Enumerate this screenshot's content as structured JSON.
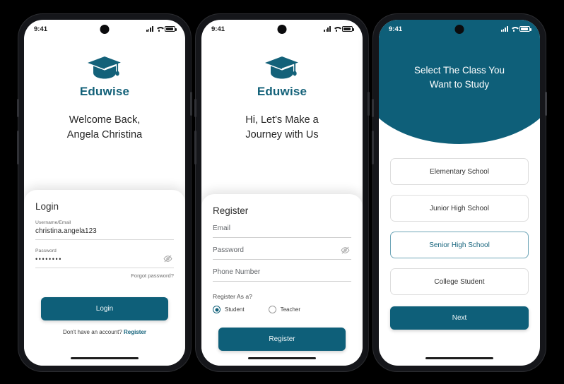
{
  "app": {
    "brand": "Eduwise",
    "accent": "#0e5f79",
    "logo_icon": "graduation-cap-icon"
  },
  "status_bar": {
    "time": "9:41",
    "icons": [
      "signal-icon",
      "wifi-icon",
      "battery-icon"
    ]
  },
  "screens": [
    {
      "id": "login",
      "headline": "Welcome Back,\nAngela Christina",
      "headline_line1": "Welcome Back,",
      "headline_line2": "Angela Christina",
      "card_title": "Login",
      "fields": [
        {
          "label": "Username/Email",
          "value": "christina.angela123"
        },
        {
          "label": "Password",
          "value": "••••••••",
          "trailing_icon": "eye-off-icon"
        }
      ],
      "forgot_label": "Forgot password?",
      "submit_label": "Login",
      "footer_text": "Don't have an account?",
      "footer_link": "Register"
    },
    {
      "id": "register",
      "headline_line1": "Hi, Let's Make a",
      "headline_line2": "Journey with Us",
      "card_title": "Register",
      "fields": [
        {
          "placeholder": "Email"
        },
        {
          "placeholder": "Password",
          "trailing_icon": "eye-off-icon"
        },
        {
          "placeholder": "Phone Number"
        }
      ],
      "role_question": "Register As a?",
      "roles": [
        {
          "label": "Student",
          "selected": true
        },
        {
          "label": "Teacher",
          "selected": false
        }
      ],
      "submit_label": "Register"
    },
    {
      "id": "class-select",
      "hero_line1": "Select The Class You",
      "hero_line2": "Want to Study",
      "options": [
        {
          "label": "Elementary School",
          "selected": false
        },
        {
          "label": "Junior High School",
          "selected": false
        },
        {
          "label": "Senior High School",
          "selected": true
        },
        {
          "label": "College Student",
          "selected": false
        }
      ],
      "next_label": "Next"
    }
  ]
}
